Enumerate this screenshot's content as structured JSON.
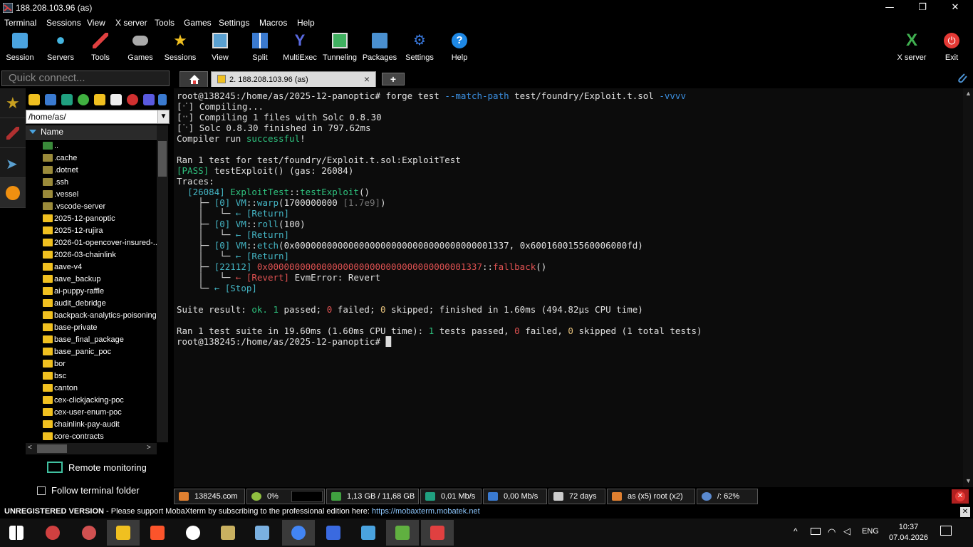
{
  "window": {
    "title": "188.208.103.96 (as)",
    "minimize": "—",
    "maximize": "❐",
    "close": "✕"
  },
  "menu": [
    "Terminal",
    "Sessions",
    "View",
    "X server",
    "Tools",
    "Games",
    "Settings",
    "Macros",
    "Help"
  ],
  "toolbar": {
    "left": [
      {
        "label": "Session",
        "icon": "session-icon",
        "color": "#4aa3df"
      },
      {
        "label": "Servers",
        "icon": "servers-icon",
        "color": "#44b5e0"
      },
      {
        "label": "Tools",
        "icon": "tools-icon",
        "color": "#e04040"
      },
      {
        "label": "Games",
        "icon": "games-icon",
        "color": "#aaaaaa"
      },
      {
        "label": "Sessions",
        "icon": "star-icon",
        "color": "#f0c020"
      },
      {
        "label": "View",
        "icon": "view-icon",
        "color": "#5aa0d0"
      },
      {
        "label": "Split",
        "icon": "split-icon",
        "color": "#3a7ad0"
      },
      {
        "label": "MultiExec",
        "icon": "multiexec-icon",
        "color": "#5a6ae0"
      },
      {
        "label": "Tunneling",
        "icon": "tunneling-icon",
        "color": "#40b060"
      },
      {
        "label": "Packages",
        "icon": "packages-icon",
        "color": "#4a90d0"
      },
      {
        "label": "Settings",
        "icon": "settings-icon",
        "color": "#3a7ae0"
      },
      {
        "label": "Help",
        "icon": "help-icon",
        "color": "#1e88e5"
      }
    ],
    "right": [
      {
        "label": "X server",
        "icon": "x-server-icon",
        "color": "#40b050"
      },
      {
        "label": "Exit",
        "icon": "power-icon",
        "color": "#e53935"
      }
    ]
  },
  "quick_connect": {
    "placeholder": "Quick connect..."
  },
  "tabs": {
    "active_label": "2. 188.208.103.96 (as)",
    "new_tab": "+"
  },
  "sidebar": {
    "path": "/home/as/",
    "column_header": "Name",
    "files": [
      {
        "name": "..",
        "kind": "up"
      },
      {
        "name": ".cache",
        "kind": "hidden"
      },
      {
        "name": ".dotnet",
        "kind": "hidden"
      },
      {
        "name": ".ssh",
        "kind": "hidden"
      },
      {
        "name": ".vessel",
        "kind": "hidden"
      },
      {
        "name": ".vscode-server",
        "kind": "hidden"
      },
      {
        "name": "2025-12-panoptic",
        "kind": "folder"
      },
      {
        "name": "2025-12-rujira",
        "kind": "folder"
      },
      {
        "name": "2026-01-opencover-insured-...",
        "kind": "folder"
      },
      {
        "name": "2026-03-chainlink",
        "kind": "folder"
      },
      {
        "name": "aave-v4",
        "kind": "folder"
      },
      {
        "name": "aave_backup",
        "kind": "folder"
      },
      {
        "name": "ai-puppy-raffle",
        "kind": "folder"
      },
      {
        "name": "audit_debridge",
        "kind": "folder"
      },
      {
        "name": "backpack-analytics-poisoning",
        "kind": "folder"
      },
      {
        "name": "base-private",
        "kind": "folder"
      },
      {
        "name": "base_final_package",
        "kind": "folder"
      },
      {
        "name": "base_panic_poc",
        "kind": "folder"
      },
      {
        "name": "bor",
        "kind": "folder"
      },
      {
        "name": "bsc",
        "kind": "folder"
      },
      {
        "name": "canton",
        "kind": "folder"
      },
      {
        "name": "cex-clickjacking-poc",
        "kind": "folder"
      },
      {
        "name": "cex-user-enum-poc",
        "kind": "folder"
      },
      {
        "name": "chainlink-pay-audit",
        "kind": "folder"
      },
      {
        "name": "core-contracts",
        "kind": "folder"
      }
    ],
    "remote_monitoring": "Remote monitoring",
    "follow_folder": "Follow terminal folder"
  },
  "terminal": {
    "prompt": "root@138245:/home/as/2025-12-panoptic#",
    "cmd": "forge test",
    "cmd_flag1": "--match-path",
    "cmd_path": "test/foundry/Exploit.t.sol",
    "cmd_flag2": "-vvvv",
    "compiling": "Compiling...",
    "compiling_files": "Compiling 1 files with Solc 0.8.30",
    "solc_finished": "Solc 0.8.30 finished in 797.62ms",
    "compiler_run": "Compiler run",
    "successful": "successful",
    "ran_test": "Ran 1 test for test/foundry/Exploit.t.sol:ExploitTest",
    "pass_tag": "[PASS]",
    "pass_rest": "testExploit() (gas: 26084)",
    "traces": "Traces:",
    "main_gas": "[26084]",
    "main_contract": "ExploitTest",
    "main_fn": "testExploit",
    "warp_arg": "1700000000",
    "warp_hint": "[1.7e9]",
    "roll_arg": "100",
    "etch_args": "0x0000000000000000000000000000000000001337, 0x600160015560006000fd",
    "fallback_gas": "[22112]",
    "fallback_addr": "0x0000000000000000000000000000000000001337",
    "revert_msg": "EvmError: Revert",
    "suite_ok": "ok.",
    "suite_rest": "finished in 1.60ms (494.82µs CPU time)",
    "ran_suite": "Ran 1 test suite in 19.60ms (1.60ms CPU time):",
    "total_tests": "(1 total tests)"
  },
  "status": {
    "host": "138245.com",
    "cpu": "0%",
    "memory": "1,13 GB / 11,68 GB",
    "upload": "0,01 Mb/s",
    "download": "0,00 Mb/s",
    "uptime": "72 days",
    "users": "as (x5)  root (x2)",
    "disk": "/: 62%"
  },
  "unregistered": {
    "title": "UNREGISTERED VERSION",
    "message": " -  Please support MobaXterm by subscribing to the professional edition here: ",
    "link": "https://mobaxterm.mobatek.net"
  },
  "taskbar": {
    "apps": [
      {
        "name": "windows-start-icon",
        "color": "#ffffff"
      },
      {
        "name": "no-entry-app-icon",
        "color": "#d04040"
      },
      {
        "name": "bird-app-icon",
        "color": "#d05050"
      },
      {
        "name": "file-explorer-icon",
        "color": "#f0c020"
      },
      {
        "name": "brave-browser-icon",
        "color": "#fb542b"
      },
      {
        "name": "recorder-icon",
        "color": "#ffffff"
      },
      {
        "name": "lock-app-icon",
        "color": "#c8b060"
      },
      {
        "name": "notes-app-icon",
        "color": "#7ab0e0"
      },
      {
        "name": "chrome-icon",
        "color": "#4285f4"
      },
      {
        "name": "chart-app-icon",
        "color": "#3a6ae0"
      },
      {
        "name": "v-app-icon",
        "color": "#4aa3df"
      },
      {
        "name": "editor-app-icon",
        "color": "#60b040"
      },
      {
        "name": "mobaxterm-icon",
        "color": "#e04040"
      }
    ],
    "language": "ENG",
    "time": "10:37",
    "date": "07.04.2026"
  }
}
